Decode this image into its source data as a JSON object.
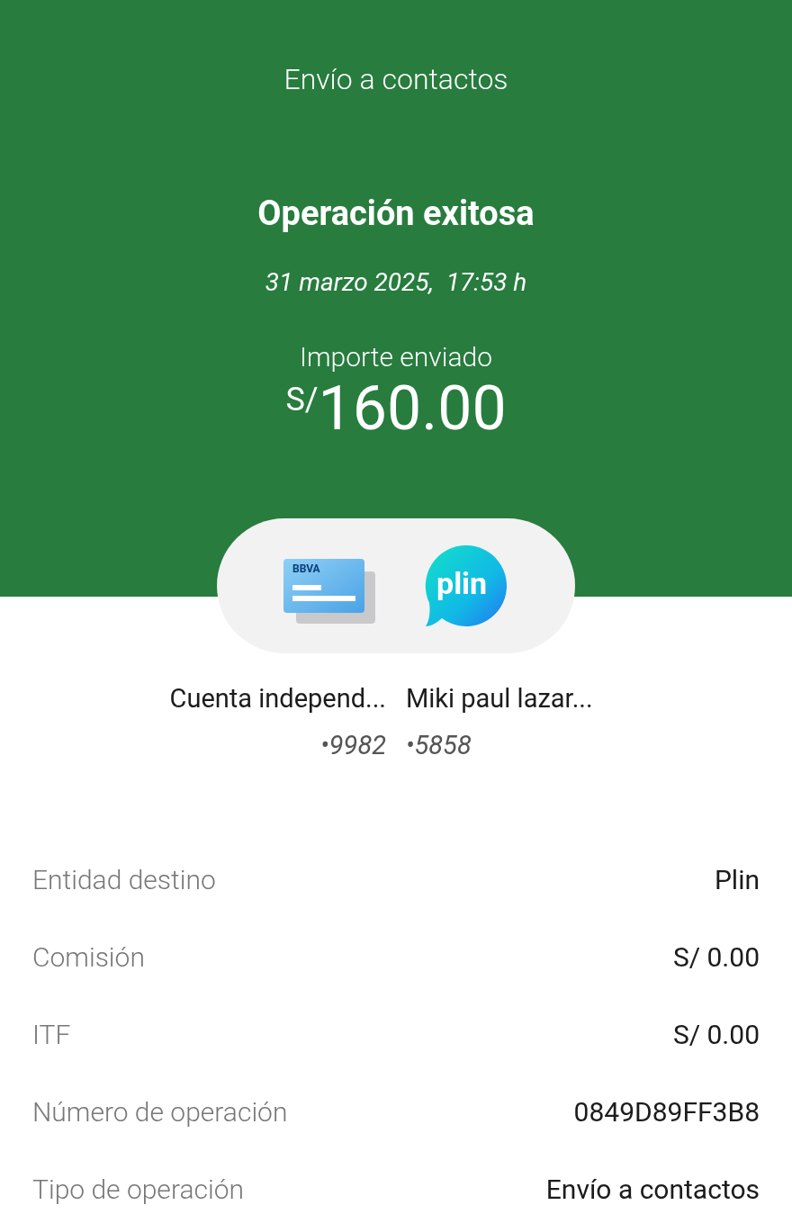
{
  "header": {
    "title": "Envío a contactos",
    "status": "Operación exitosa",
    "datetime": "31 marzo 2025,  17:53 h",
    "amount_label": "Importe enviado",
    "currency": "S/",
    "amount": "160.00"
  },
  "transfer": {
    "origin": {
      "logo_text": "BBVA",
      "name": "Cuenta independ...",
      "number": "•9982"
    },
    "destination": {
      "logo_text": "plin",
      "name": "Miki paul lazar...",
      "number": "•5858"
    }
  },
  "details": [
    {
      "label": "Entidad destino",
      "value": "Plin"
    },
    {
      "label": "Comisión",
      "value": "S/ 0.00"
    },
    {
      "label": "ITF",
      "value": "S/ 0.00"
    },
    {
      "label": "Número de operación",
      "value": "0849D89FF3B8"
    },
    {
      "label": "Tipo de operación",
      "value": "Envío a contactos"
    }
  ]
}
